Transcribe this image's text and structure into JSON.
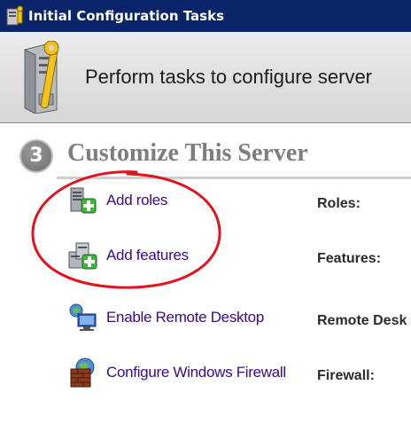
{
  "window": {
    "title": "Initial Configuration Tasks"
  },
  "banner": {
    "subtitle": "Perform tasks to configure server"
  },
  "section": {
    "number": "3",
    "title": "Customize This Server"
  },
  "tasks": [
    {
      "label": "Add roles",
      "property": "Roles:",
      "icon": "add-roles-icon"
    },
    {
      "label": "Add features",
      "property": "Features:",
      "icon": "add-features-icon"
    },
    {
      "label": "Enable Remote Desktop",
      "property": "Remote Desk",
      "icon": "remote-desktop-icon"
    },
    {
      "label": "Configure Windows Firewall",
      "property": "Firewall:",
      "icon": "firewall-icon"
    }
  ],
  "colors": {
    "titlebar": "#0a246a",
    "link": "#3a0a8c",
    "annotation": "#e0141e"
  }
}
